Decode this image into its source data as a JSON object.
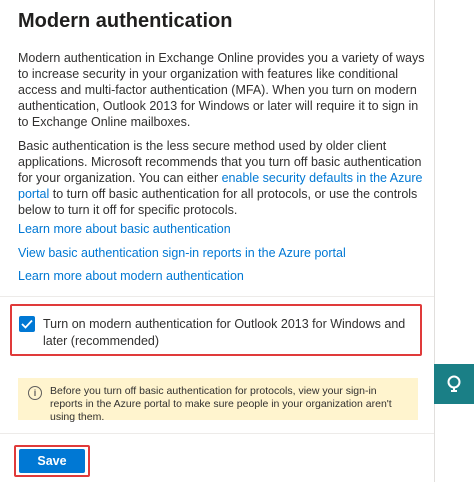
{
  "panel": {
    "title": "Modern authentication",
    "paragraph1": "Modern authentication in Exchange Online provides you a variety of ways to increase security in your organization with features like conditional access and multi-factor authentication (MFA). When you turn on modern authentication, Outlook 2013 for Windows or later will require it to sign in to Exchange Online mailboxes.",
    "paragraph2_before": "Basic authentication is the less secure method used by older client applications. Microsoft recommends that you turn off basic authentication for your organization. You can either ",
    "paragraph2_link": "enable security defaults in the Azure portal",
    "paragraph2_after": " to turn off basic authentication for all protocols, or use the controls below to turn it off for specific protocols.",
    "links": [
      "Learn more about basic authentication",
      "View basic authentication sign-in reports in the Azure portal",
      "Learn more about modern authentication"
    ],
    "checkbox_label": "Turn on modern authentication for Outlook 2013 for Windows and later (recommended)",
    "checkbox_checked": true,
    "note_text": "Before you turn off basic authentication for protocols, view your sign-in reports in the Azure portal to make sure people in your organization aren't using them.",
    "note_icon": "info-icon",
    "save_label": "Save"
  },
  "colors": {
    "accent": "#0078d4",
    "highlight": "#e03a3a",
    "note_bg": "#fff4ce",
    "side_button": "#1a7f86"
  },
  "side_button_icon": "feedback-icon"
}
